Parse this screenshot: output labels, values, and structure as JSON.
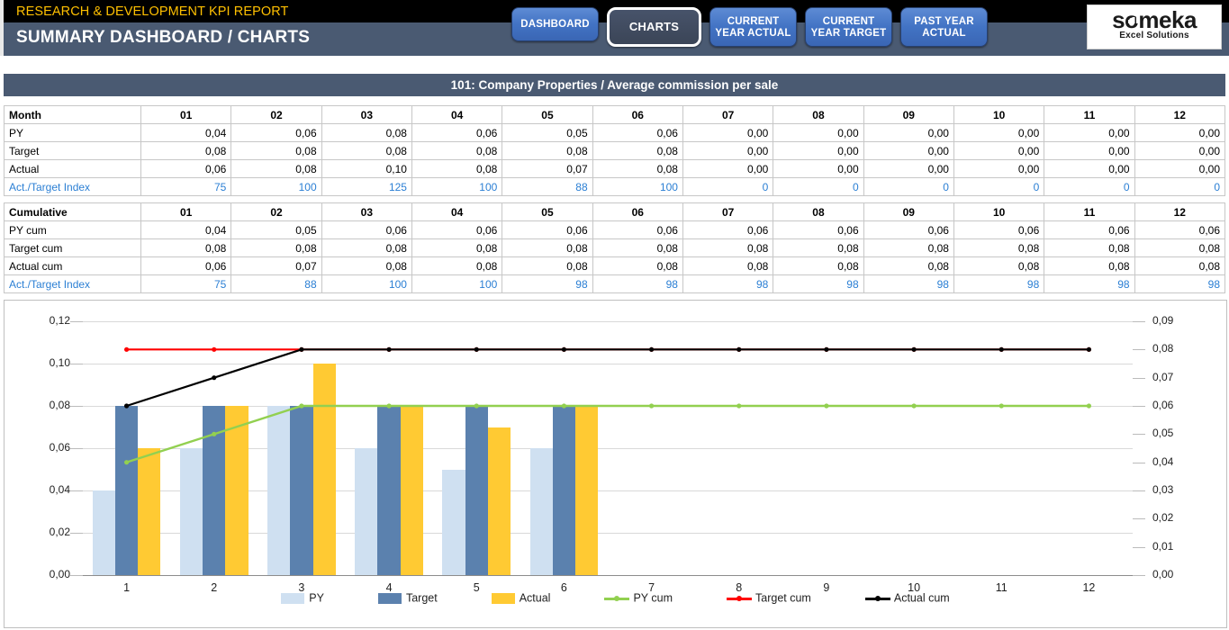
{
  "header": {
    "kpi_title": "RESEARCH & DEVELOPMENT KPI REPORT",
    "dashboard_title": "SUMMARY DASHBOARD / CHARTS",
    "nav_buttons": [
      {
        "id": "dashboard",
        "lines": [
          "DASHBOARD"
        ],
        "active": false
      },
      {
        "id": "charts",
        "lines": [
          "CHARTS"
        ],
        "active": true
      },
      {
        "id": "current-year-actual",
        "lines": [
          "CURRENT",
          "YEAR ACTUAL"
        ],
        "active": false
      },
      {
        "id": "current-year-target",
        "lines": [
          "CURRENT",
          "YEAR TARGET"
        ],
        "active": false
      },
      {
        "id": "past-year-actual",
        "lines": [
          "PAST YEAR",
          "ACTUAL"
        ],
        "active": false
      }
    ],
    "logo": {
      "main": "someka",
      "sub": "Excel Solutions"
    }
  },
  "section": {
    "title": "101: Company Properties / Average commission per sale"
  },
  "table_monthly": {
    "corner_label": "Month",
    "columns": [
      "01",
      "02",
      "03",
      "04",
      "05",
      "06",
      "07",
      "08",
      "09",
      "10",
      "11",
      "12"
    ],
    "rows": [
      {
        "label": "PY",
        "values": [
          "0,04",
          "0,06",
          "0,08",
          "0,06",
          "0,05",
          "0,06",
          "0,00",
          "0,00",
          "0,00",
          "0,00",
          "0,00",
          "0,00"
        ],
        "index": false
      },
      {
        "label": "Target",
        "values": [
          "0,08",
          "0,08",
          "0,08",
          "0,08",
          "0,08",
          "0,08",
          "0,00",
          "0,00",
          "0,00",
          "0,00",
          "0,00",
          "0,00"
        ],
        "index": false
      },
      {
        "label": "Actual",
        "values": [
          "0,06",
          "0,08",
          "0,10",
          "0,08",
          "0,07",
          "0,08",
          "0,00",
          "0,00",
          "0,00",
          "0,00",
          "0,00",
          "0,00"
        ],
        "index": false
      },
      {
        "label": "Act./Target Index",
        "values": [
          "75",
          "100",
          "125",
          "100",
          "88",
          "100",
          "0",
          "0",
          "0",
          "0",
          "0",
          "0"
        ],
        "index": true
      }
    ]
  },
  "table_cumulative": {
    "corner_label": "Cumulative",
    "columns": [
      "01",
      "02",
      "03",
      "04",
      "05",
      "06",
      "07",
      "08",
      "09",
      "10",
      "11",
      "12"
    ],
    "rows": [
      {
        "label": "PY cum",
        "values": [
          "0,04",
          "0,05",
          "0,06",
          "0,06",
          "0,06",
          "0,06",
          "0,06",
          "0,06",
          "0,06",
          "0,06",
          "0,06",
          "0,06"
        ],
        "index": false
      },
      {
        "label": "Target cum",
        "values": [
          "0,08",
          "0,08",
          "0,08",
          "0,08",
          "0,08",
          "0,08",
          "0,08",
          "0,08",
          "0,08",
          "0,08",
          "0,08",
          "0,08"
        ],
        "index": false
      },
      {
        "label": "Actual cum",
        "values": [
          "0,06",
          "0,07",
          "0,08",
          "0,08",
          "0,08",
          "0,08",
          "0,08",
          "0,08",
          "0,08",
          "0,08",
          "0,08",
          "0,08"
        ],
        "index": false
      },
      {
        "label": "Act./Target Index",
        "values": [
          "75",
          "88",
          "100",
          "100",
          "98",
          "98",
          "98",
          "98",
          "98",
          "98",
          "98",
          "98"
        ],
        "index": true
      }
    ]
  },
  "chart_data": {
    "type": "bar",
    "title": "",
    "xlabel": "",
    "ylabel": "",
    "categories": [
      "1",
      "2",
      "3",
      "4",
      "5",
      "6",
      "7",
      "8",
      "9",
      "10",
      "11",
      "12"
    ],
    "grid": true,
    "legend_position": "bottom",
    "y_left": {
      "min": 0,
      "max": 0.12,
      "step": 0.02,
      "ticks": [
        "0,00",
        "0,02",
        "0,04",
        "0,06",
        "0,08",
        "0,10",
        "0,12"
      ]
    },
    "y_right": {
      "min": 0,
      "max": 0.09,
      "step": 0.01,
      "ticks": [
        "0,00",
        "0,01",
        "0,02",
        "0,03",
        "0,04",
        "0,05",
        "0,06",
        "0,07",
        "0,08",
        "0,09"
      ]
    },
    "bar_series": [
      {
        "name": "PY",
        "color": "#cfe0f1",
        "axis": "left",
        "values": [
          0.04,
          0.06,
          0.08,
          0.06,
          0.05,
          0.06,
          0,
          0,
          0,
          0,
          0,
          0
        ]
      },
      {
        "name": "Target",
        "color": "#5b81ae",
        "axis": "left",
        "values": [
          0.08,
          0.08,
          0.08,
          0.08,
          0.08,
          0.08,
          0,
          0,
          0,
          0,
          0,
          0
        ]
      },
      {
        "name": "Actual",
        "color": "#ffca33",
        "axis": "left",
        "values": [
          0.06,
          0.08,
          0.1,
          0.08,
          0.07,
          0.08,
          0,
          0,
          0,
          0,
          0,
          0
        ]
      }
    ],
    "line_series": [
      {
        "name": "PY cum",
        "color": "#92d050",
        "axis": "right",
        "values": [
          0.04,
          0.05,
          0.06,
          0.06,
          0.06,
          0.06,
          0.06,
          0.06,
          0.06,
          0.06,
          0.06,
          0.06
        ]
      },
      {
        "name": "Target cum",
        "color": "#ff0000",
        "axis": "right",
        "values": [
          0.08,
          0.08,
          0.08,
          0.08,
          0.08,
          0.08,
          0.08,
          0.08,
          0.08,
          0.08,
          0.08,
          0.08
        ]
      },
      {
        "name": "Actual cum",
        "color": "#000000",
        "axis": "right",
        "values": [
          0.06,
          0.07,
          0.08,
          0.08,
          0.08,
          0.08,
          0.08,
          0.08,
          0.08,
          0.08,
          0.08,
          0.08
        ]
      }
    ],
    "legend": [
      "PY",
      "Target",
      "Actual",
      "PY cum",
      "Target cum",
      "Actual cum"
    ]
  }
}
